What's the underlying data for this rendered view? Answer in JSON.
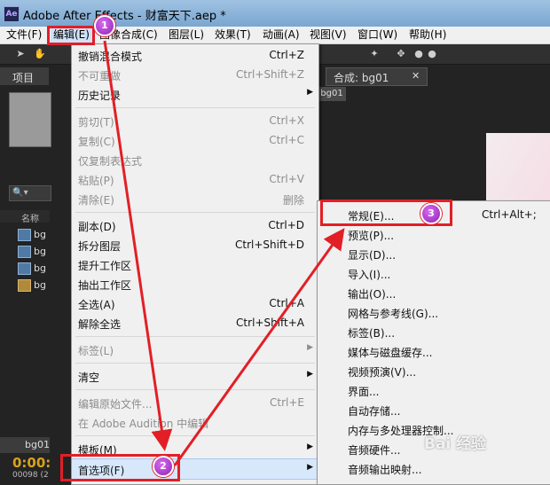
{
  "window": {
    "logo": "Ae",
    "title": "Adobe After Effects - 财富天下.aep *"
  },
  "menubar": [
    "文件(F)",
    "编辑(E)",
    "图像合成(C)",
    "图层(L)",
    "效果(T)",
    "动画(A)",
    "视图(V)",
    "窗口(W)",
    "帮助(H)"
  ],
  "panels": {
    "project_tab": "项目",
    "column_name": "名称",
    "project_rows": [
      "bg",
      "bg",
      "bg",
      "bg"
    ],
    "comp_tab": "合成: bg01",
    "comp_subtab": "bg01",
    "timeline_tab": "bg01",
    "timecode": "0:00:",
    "frames": "00098 (2"
  },
  "edit_menu": {
    "items": [
      {
        "label": "撤销混合模式",
        "shortcut": "Ctrl+Z",
        "enabled": true
      },
      {
        "label": "不可重做",
        "shortcut": "Ctrl+Shift+Z",
        "enabled": false
      },
      {
        "label": "历史记录",
        "submenu": true,
        "enabled": true
      },
      {
        "label": "剪切(T)",
        "shortcut": "Ctrl+X",
        "enabled": false
      },
      {
        "label": "复制(C)",
        "shortcut": "Ctrl+C",
        "enabled": false
      },
      {
        "label": "仅复制表达式",
        "enabled": false
      },
      {
        "label": "粘贴(P)",
        "shortcut": "Ctrl+V",
        "enabled": false
      },
      {
        "label": "清除(E)",
        "shortcut": "删除",
        "enabled": false
      },
      {
        "label": "副本(D)",
        "shortcut": "Ctrl+D",
        "enabled": true
      },
      {
        "label": "拆分图层",
        "shortcut": "Ctrl+Shift+D",
        "enabled": true
      },
      {
        "label": "提升工作区",
        "enabled": true
      },
      {
        "label": "抽出工作区",
        "enabled": true
      },
      {
        "label": "全选(A)",
        "shortcut": "Ctrl+A",
        "enabled": true
      },
      {
        "label": "解除全选",
        "shortcut": "Ctrl+Shift+A",
        "enabled": true
      },
      {
        "label": "标签(L)",
        "submenu": true,
        "enabled": false
      },
      {
        "label": "清空",
        "submenu": true,
        "enabled": true
      },
      {
        "label": "编辑原始文件...",
        "shortcut": "Ctrl+E",
        "enabled": false
      },
      {
        "label": "在 Adobe Audition 中编辑",
        "enabled": false
      },
      {
        "label": "模板(M)",
        "submenu": true,
        "enabled": true
      },
      {
        "label": "首选项(F)",
        "submenu": true,
        "enabled": true,
        "highlighted": true
      }
    ]
  },
  "preferences_menu": {
    "items": [
      {
        "label": "常规(E)...",
        "shortcut": "Ctrl+Alt+;"
      },
      {
        "label": "预览(P)..."
      },
      {
        "label": "显示(D)..."
      },
      {
        "label": "导入(I)..."
      },
      {
        "label": "输出(O)..."
      },
      {
        "label": "网格与参考线(G)..."
      },
      {
        "label": "标签(B)..."
      },
      {
        "label": "媒体与磁盘缓存..."
      },
      {
        "label": "视频预演(V)..."
      },
      {
        "label": "界面..."
      },
      {
        "label": "自动存储..."
      },
      {
        "label": "内存与多处理器控制..."
      },
      {
        "label": "音频硬件..."
      },
      {
        "label": "音频输出映射..."
      }
    ]
  },
  "annotations": {
    "badges": [
      "1",
      "2",
      "3"
    ],
    "watermark": "Bai 经验"
  },
  "colors": {
    "annotation_red": "#e21f26",
    "badge_purple": "#a53ac8",
    "menu_highlight": "#d7e8fb"
  }
}
